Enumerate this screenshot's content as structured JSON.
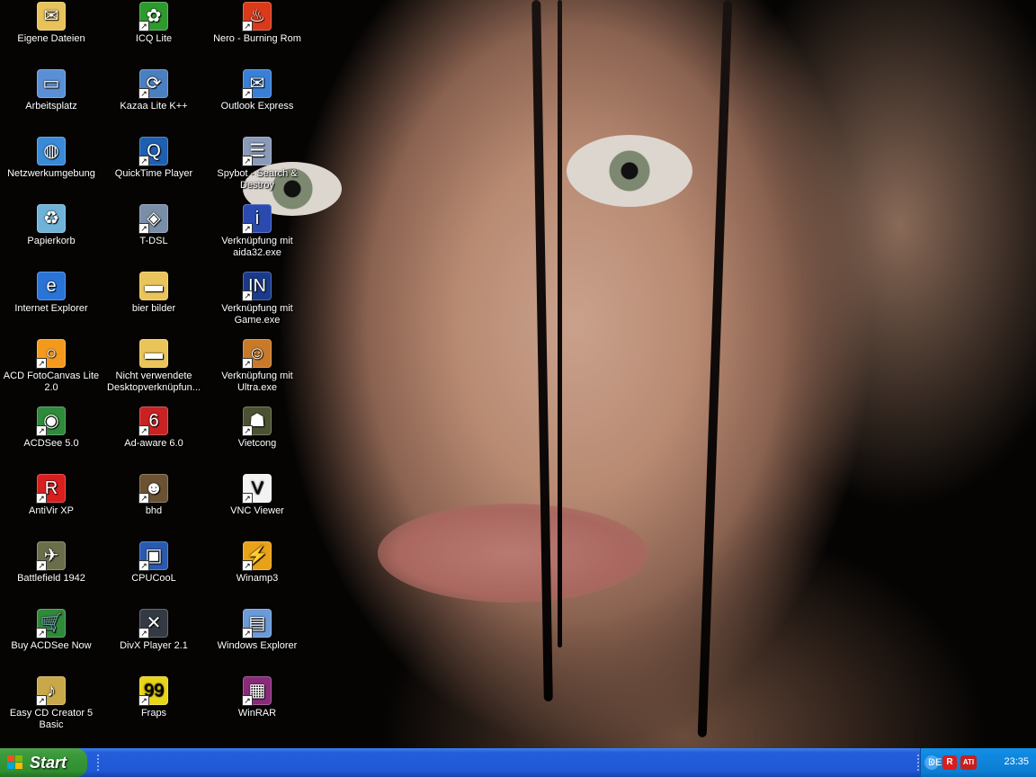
{
  "desktop": {
    "icons": [
      {
        "label": "Eigene Dateien",
        "icon": "my-documents-icon",
        "shortcut": false,
        "color": "#e8c25a",
        "glyph": "✉"
      },
      {
        "label": "Arbeitsplatz",
        "icon": "my-computer-icon",
        "shortcut": false,
        "color": "#5a8fd6",
        "glyph": "▭"
      },
      {
        "label": "Netzwerkumgebung",
        "icon": "network-icon",
        "shortcut": false,
        "color": "#3a8ad8",
        "glyph": "◍"
      },
      {
        "label": "Papierkorb",
        "icon": "recycle-bin-icon",
        "shortcut": false,
        "color": "#6fb3d8",
        "glyph": "♻"
      },
      {
        "label": "Internet Explorer",
        "icon": "internet-explorer-icon",
        "shortcut": false,
        "color": "#2a74d8",
        "glyph": "e"
      },
      {
        "label": "ACD FotoCanvas Lite 2.0",
        "icon": "fotocanvas-icon",
        "shortcut": true,
        "color": "#f39a1e",
        "glyph": "○"
      },
      {
        "label": "ACDSee 5.0",
        "icon": "acdsee-icon",
        "shortcut": true,
        "color": "#2f8a3a",
        "glyph": "◉"
      },
      {
        "label": "AntiVir XP",
        "icon": "antivir-icon",
        "shortcut": true,
        "color": "#d81e1e",
        "glyph": "R"
      },
      {
        "label": "Battlefield 1942",
        "icon": "battlefield-icon",
        "shortcut": true,
        "color": "#6b6e4a",
        "glyph": "✈"
      },
      {
        "label": "Buy ACDSee Now",
        "icon": "cart-icon",
        "shortcut": true,
        "color": "#2f8a3a",
        "glyph": "🛒"
      },
      {
        "label": "Easy CD Creator 5 Basic",
        "icon": "cd-creator-icon",
        "shortcut": true,
        "color": "#c9a84a",
        "glyph": "♪"
      },
      {
        "label": "ICQ Lite",
        "icon": "icq-icon",
        "shortcut": true,
        "color": "#2e9a2e",
        "glyph": "✿"
      },
      {
        "label": "Kazaa Lite K++",
        "icon": "kazaa-icon",
        "shortcut": true,
        "color": "#4a7fc0",
        "glyph": "⟳"
      },
      {
        "label": "QuickTime Player",
        "icon": "quicktime-icon",
        "shortcut": true,
        "color": "#1e5fb0",
        "glyph": "Q"
      },
      {
        "label": "T-DSL",
        "icon": "tdsl-icon",
        "shortcut": true,
        "color": "#7a8ea8",
        "glyph": "◈"
      },
      {
        "label": "bier bilder",
        "icon": "folder-icon",
        "shortcut": false,
        "color": "#e9c45a",
        "glyph": "▬"
      },
      {
        "label": "Nicht verwendete Desktopverknüpfun...",
        "icon": "folder-icon",
        "shortcut": false,
        "color": "#e9c45a",
        "glyph": "▬"
      },
      {
        "label": "Ad-aware 6.0",
        "icon": "adaware-icon",
        "shortcut": true,
        "color": "#c82222",
        "glyph": "6"
      },
      {
        "label": "bhd",
        "icon": "bhd-icon",
        "shortcut": true,
        "color": "#6a5232",
        "glyph": "☻"
      },
      {
        "label": "CPUCooL",
        "icon": "cpucool-icon",
        "shortcut": true,
        "color": "#2a5ab0",
        "glyph": "▣"
      },
      {
        "label": "DivX Player 2.1",
        "icon": "divx-icon",
        "shortcut": true,
        "color": "#333a44",
        "glyph": "✕"
      },
      {
        "label": "Fraps",
        "icon": "fraps-icon",
        "shortcut": true,
        "color": "#e8d41a",
        "glyph": "99"
      },
      {
        "label": "Nero - Burning Rom",
        "icon": "nero-icon",
        "shortcut": true,
        "color": "#d83a1a",
        "glyph": "♨"
      },
      {
        "label": "Outlook Express",
        "icon": "outlook-express-icon",
        "shortcut": true,
        "color": "#3a7fd6",
        "glyph": "✉"
      },
      {
        "label": "Spybot - Search & Destroy",
        "icon": "spybot-icon",
        "shortcut": true,
        "color": "#8a9ab8",
        "glyph": "☰"
      },
      {
        "label": "Verknüpfung mit aida32.exe",
        "icon": "aida32-icon",
        "shortcut": true,
        "color": "#2a4ab0",
        "glyph": "i"
      },
      {
        "label": "Verknüpfung mit Game.exe",
        "icon": "game-icon",
        "shortcut": true,
        "color": "#1a3a8a",
        "glyph": "IN"
      },
      {
        "label": "Verknüpfung mit Ultra.exe",
        "icon": "ultra-icon",
        "shortcut": true,
        "color": "#c87a2a",
        "glyph": "☺"
      },
      {
        "label": "Vietcong",
        "icon": "vietcong-icon",
        "shortcut": true,
        "color": "#4a5232",
        "glyph": "☗"
      },
      {
        "label": "VNC Viewer",
        "icon": "vnc-icon",
        "shortcut": true,
        "color": "#f2f2f2",
        "glyph": "V"
      },
      {
        "label": "Winamp3",
        "icon": "winamp-icon",
        "shortcut": true,
        "color": "#e8a21a",
        "glyph": "⚡"
      },
      {
        "label": "Windows Explorer",
        "icon": "windows-explorer-icon",
        "shortcut": true,
        "color": "#6a9ad8",
        "glyph": "▤"
      },
      {
        "label": "WinRAR",
        "icon": "winrar-icon",
        "shortcut": true,
        "color": "#8a2a7a",
        "glyph": "▦"
      }
    ]
  },
  "taskbar": {
    "start_label": "Start",
    "language": "DE",
    "clock": "23:35",
    "tray_icons": [
      {
        "name": "show-hidden-icon",
        "glyph": "‹",
        "color": "#0a6cbc"
      },
      {
        "name": "antivir-tray-icon",
        "glyph": "R",
        "color": "#d81e1e"
      },
      {
        "name": "ati-tray-icon",
        "glyph": "ATI",
        "color": "#c81e1e"
      }
    ]
  }
}
